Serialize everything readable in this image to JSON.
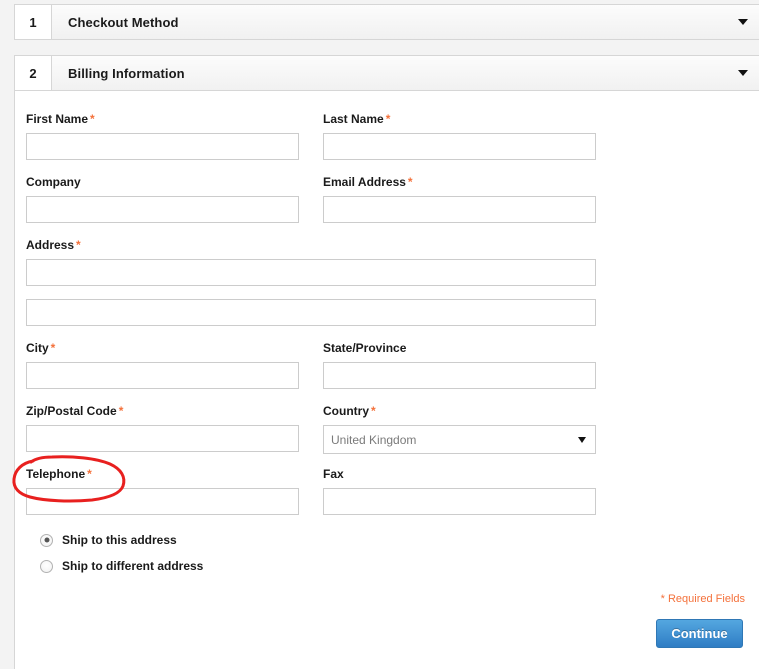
{
  "steps": [
    {
      "number": "1",
      "title": "Checkout Method",
      "chevron_icon": "chevron-down-icon"
    },
    {
      "number": "2",
      "title": "Billing Information",
      "chevron_icon": "chevron-down-icon"
    }
  ],
  "form": {
    "fields": {
      "first_name": {
        "label": "First Name",
        "required": "*",
        "value": "",
        "placeholder": ""
      },
      "last_name": {
        "label": "Last Name",
        "required": "*",
        "value": "",
        "placeholder": ""
      },
      "company": {
        "label": "Company",
        "required": "",
        "value": "",
        "placeholder": ""
      },
      "email": {
        "label": "Email Address",
        "required": "*",
        "value": "",
        "placeholder": ""
      },
      "address": {
        "label": "Address",
        "required": "*",
        "value": "",
        "placeholder": ""
      },
      "address2": {
        "label": "",
        "required": "",
        "value": "",
        "placeholder": ""
      },
      "city": {
        "label": "City",
        "required": "*",
        "value": "",
        "placeholder": ""
      },
      "state": {
        "label": "State/Province",
        "required": "",
        "value": "",
        "placeholder": ""
      },
      "zip": {
        "label": "Zip/Postal Code",
        "required": "*",
        "value": "",
        "placeholder": ""
      },
      "country": {
        "label": "Country",
        "required": "*",
        "value": "United Kingdom",
        "options": [
          "United Kingdom"
        ]
      },
      "telephone": {
        "label": "Telephone",
        "required": "*",
        "value": "",
        "placeholder": ""
      },
      "fax": {
        "label": "Fax",
        "required": "",
        "value": "",
        "placeholder": ""
      }
    },
    "shipping_options": [
      {
        "label": "Ship to this address",
        "selected": true
      },
      {
        "label": "Ship to different address",
        "selected": false
      }
    ],
    "required_note": "* Required Fields",
    "continue_label": "Continue"
  },
  "annotation": {
    "type": "hand-drawn-ellipse",
    "target": "telephone-label",
    "color": "#e8201f"
  },
  "colors": {
    "required_asterisk": "#f4713b",
    "button_primary": "#2f7dc4",
    "annotation_red": "#e8201f",
    "border_gray": "#cccccc",
    "text_dark": "#1a1a1a"
  }
}
